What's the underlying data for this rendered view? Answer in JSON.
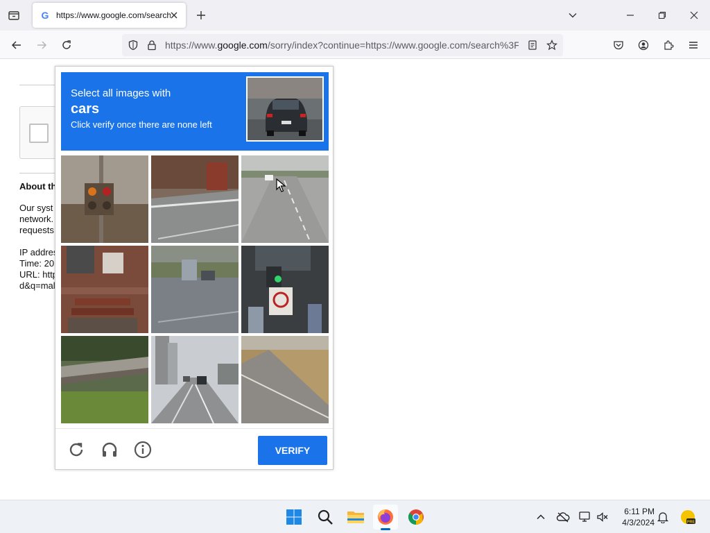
{
  "browser": {
    "tab": {
      "title": "https://www.google.com/search",
      "favicon": "google-g-icon"
    },
    "url": {
      "prefix": "https://www.",
      "domain": "google.com",
      "rest": "/sorry/index?continue=https://www.google.com/search%3F"
    }
  },
  "background_page": {
    "about_heading": "About th",
    "paragraph_lines": [
      "Our syst",
      "network.",
      "requests"
    ],
    "info_lines": [
      "IP addres",
      "Time: 20",
      "URL: http",
      "d&q=mal"
    ]
  },
  "captcha": {
    "instruction_line1": "Select all images with",
    "target": "cars",
    "instruction_line3": "Click verify once there are none left",
    "verify_label": "VERIFY",
    "header_color": "#1a73e8",
    "tiles": [
      "traffic light on pole",
      "road edge with building",
      "highway with distant car",
      "brick building with steps",
      "road with truck and car",
      "traffic light and signs",
      "overpass with grass",
      "road with cars and buildings",
      "road with dry field"
    ]
  },
  "taskbar": {
    "apps": [
      "windows-start-icon",
      "search-icon",
      "file-explorer-icon",
      "firefox-icon",
      "chrome-icon"
    ],
    "clock_time": "6:11 PM",
    "clock_date": "4/3/2024"
  }
}
